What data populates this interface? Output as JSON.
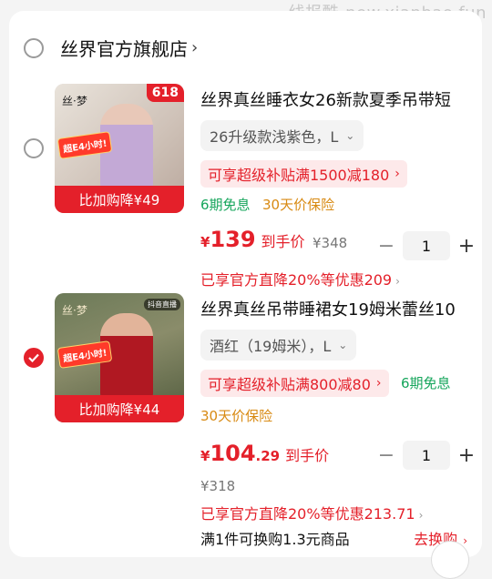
{
  "watermark": "线报酷-new.xianbao.fun",
  "shop": {
    "name": "丝界官方旗舰店",
    "chevron": "›"
  },
  "items": [
    {
      "selected": false,
      "badge": "618",
      "brand_logo": "丝·梦",
      "promo_badge": "超E4小时!",
      "image_strip": "比加购降¥49",
      "title": "丝界真丝睡衣女26新款夏季吊带短",
      "variant": "26升级款浅紫色，L",
      "subsidy": "可享超级补贴满1500减180",
      "installment": "6期免息",
      "insurance": "30天价保险",
      "price_symbol": "¥",
      "price_int": "139",
      "price_dec": "",
      "price_suffix": "到手价",
      "original_price": "¥348",
      "quantity": "1",
      "official": "已享官方直降20%等优惠209"
    },
    {
      "selected": true,
      "brand_tag": "抖音直播",
      "brand_logo": "丝·梦",
      "promo_badge": "超E4小时!",
      "image_strip": "比加购降¥44",
      "title": "丝界真丝吊带睡裙女19姆米蕾丝10",
      "variant": "酒红（19姆米），L",
      "subsidy": "可享超级补贴满800减80",
      "installment": "6期免息",
      "insurance": "30天价保险",
      "price_symbol": "¥",
      "price_int": "104",
      "price_dec": ".29",
      "price_suffix": "到手价",
      "original_price": "¥318",
      "quantity": "1",
      "official": "已享官方直降20%等优惠213.71",
      "swap_text": "满1件可换购1.3元商品",
      "swap_link": "去换购"
    }
  ],
  "icons": {
    "check": "check-icon",
    "plus": "+",
    "minus": "−",
    "chevron": "›"
  },
  "colors": {
    "accent": "#e4202a",
    "green": "#15a55b",
    "insure": "#d88a13"
  }
}
